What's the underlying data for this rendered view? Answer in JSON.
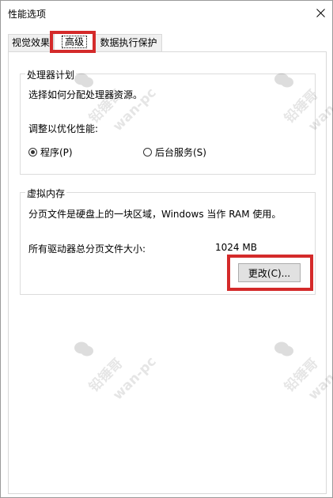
{
  "window": {
    "title": "性能选项"
  },
  "tabs": [
    {
      "label": "视觉效果"
    },
    {
      "label": "高级"
    },
    {
      "label": "数据执行保护"
    }
  ],
  "processor_group": {
    "title": "处理器计划",
    "description": "选择如何分配处理器资源。",
    "adjust_label": "调整以优化性能:",
    "options": [
      {
        "label": "程序(P)",
        "selected": true
      },
      {
        "label": "后台服务(S)",
        "selected": false
      }
    ]
  },
  "virtual_memory_group": {
    "title": "虚拟内存",
    "description": "分页文件是硬盘上的一块区域，Windows 当作 RAM 使用。",
    "total_label": "所有驱动器总分页文件大小:",
    "total_value": "1024 MB",
    "change_button": "更改(C)..."
  },
  "watermark": {
    "name": "铅锤哥",
    "handle": "wan-pc"
  },
  "colors": {
    "highlight": "#d42a2a",
    "button_bg": "#e1e1e1"
  }
}
